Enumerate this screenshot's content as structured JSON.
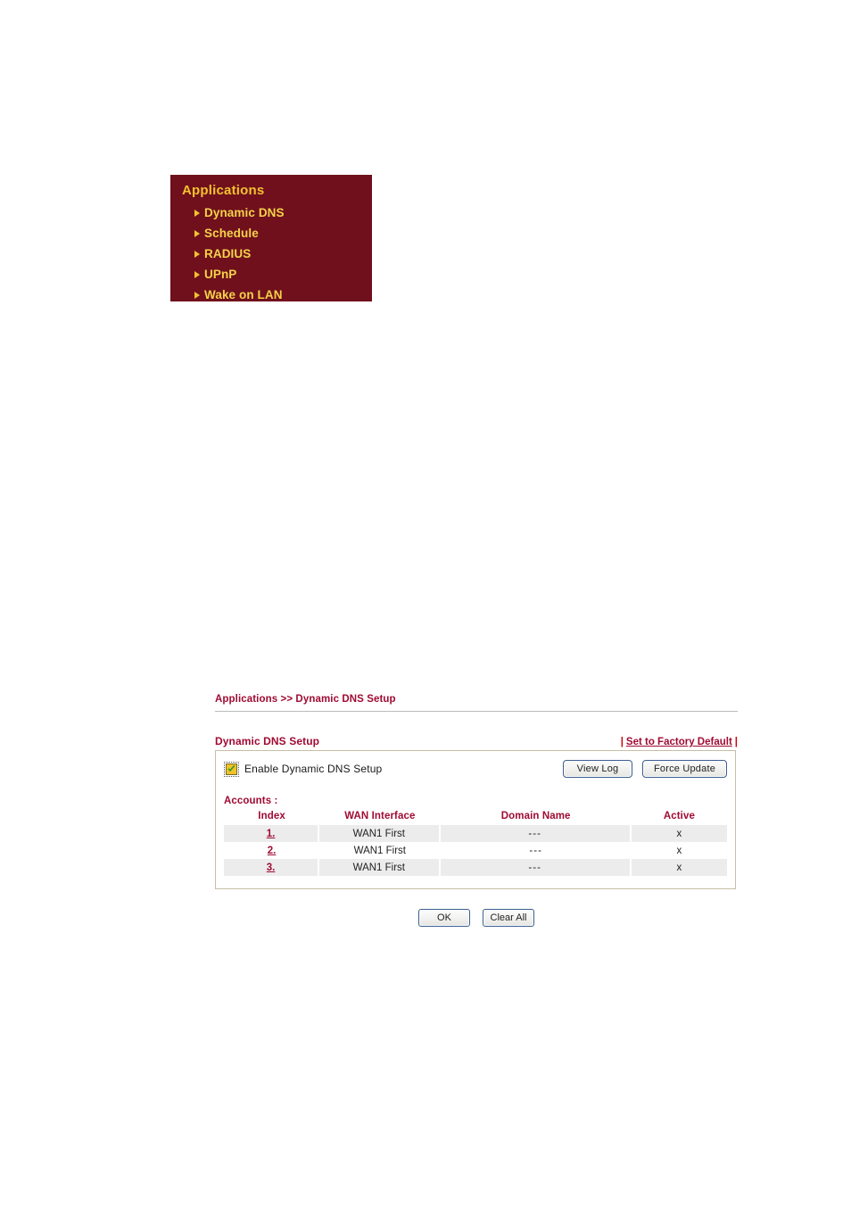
{
  "sidebar": {
    "title": "Applications",
    "items": [
      {
        "label": "Dynamic DNS"
      },
      {
        "label": "Schedule"
      },
      {
        "label": "RADIUS"
      },
      {
        "label": "UPnP"
      },
      {
        "label": "Wake on LAN"
      }
    ]
  },
  "breadcrumb": "Applications >> Dynamic DNS Setup",
  "section": {
    "title": "Dynamic DNS Setup",
    "factory_default_prefix": "|",
    "factory_default_link": "Set to Factory Default",
    "factory_default_suffix": "|"
  },
  "enable": {
    "label": "Enable Dynamic DNS Setup",
    "checked": true,
    "checkbox_icon": "checkbox-checked-icon"
  },
  "toolbar": {
    "view_log_label": "View Log",
    "force_update_label": "Force Update"
  },
  "accounts": {
    "label": "Accounts :",
    "columns": [
      "Index",
      "WAN Interface",
      "Domain Name",
      "Active"
    ],
    "rows": [
      {
        "index": "1.",
        "wan_interface": "WAN1 First",
        "domain_name": "---",
        "active": "x"
      },
      {
        "index": "2.",
        "wan_interface": "WAN1 First",
        "domain_name": "---",
        "active": "x"
      },
      {
        "index": "3.",
        "wan_interface": "WAN1 First",
        "domain_name": "---",
        "active": "x"
      }
    ]
  },
  "footer": {
    "ok_label": "OK",
    "clear_all_label": "Clear All"
  },
  "colors": {
    "menu_background": "#70101c",
    "menu_text": "#f4d24a",
    "menu_title": "#f2c230",
    "heading_text": "#a00a32",
    "link_red": "#cc0000",
    "panel_border": "#c6bfa6",
    "row_shade": "#ececec",
    "checkbox_fill": "#f0c32c",
    "checkbox_check": "#3a9a20",
    "button_border": "#3a5d8f"
  }
}
